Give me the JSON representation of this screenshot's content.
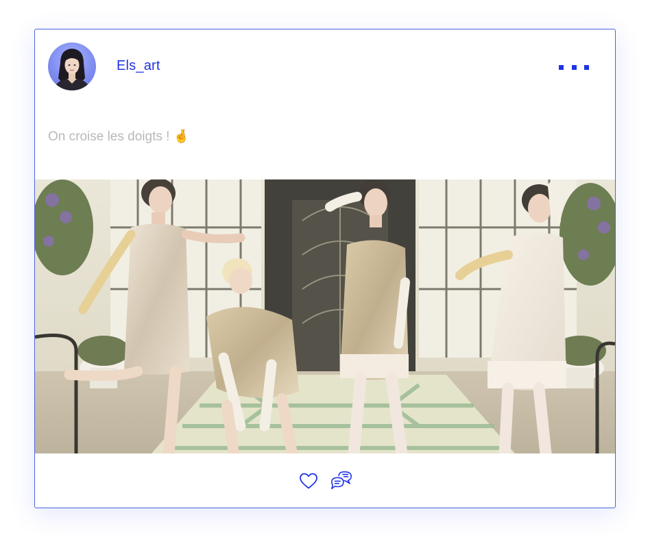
{
  "post": {
    "username": "Els_art",
    "caption": "On croise les doigts ! 🤞",
    "more_label": "more options",
    "image_description": "Four women in 1920s flapper dresses posing in a hotel lobby"
  },
  "actions": [
    {
      "icon": "heart-icon",
      "label": "like"
    },
    {
      "icon": "comment-icon",
      "label": "comment"
    }
  ],
  "colors": {
    "accent": "#1f33e6",
    "border": "#4a63e0",
    "caption": "#b8b8b8"
  }
}
